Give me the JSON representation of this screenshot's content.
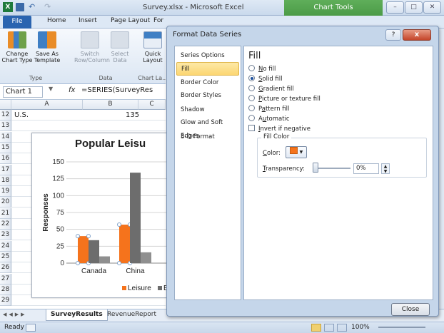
{
  "window": {
    "title": "Survey.xlsx - Microsoft Excel",
    "context_tab": "Chart Tools",
    "min": "–",
    "max": "□",
    "close": "✕"
  },
  "ribbon_tabs": [
    "File",
    "Home",
    "Insert",
    "Page Layout",
    "For"
  ],
  "ribbon": {
    "buttons": [
      {
        "label": "Change Chart Type"
      },
      {
        "label": "Save As Template"
      },
      {
        "label": "Switch Row/Column"
      },
      {
        "label": "Select Data"
      },
      {
        "label": "Quick Layout"
      }
    ],
    "groups": [
      "Type",
      "Data",
      "Chart La..."
    ]
  },
  "formula_bar": {
    "name_box": "Chart 1",
    "fx": "fx",
    "formula": "=SERIES(SurveyRes"
  },
  "sheet": {
    "columns": [
      "A",
      "B",
      "C"
    ],
    "rows": [
      "12",
      "13",
      "14",
      "15",
      "16",
      "17",
      "18",
      "19",
      "20",
      "21",
      "22",
      "23",
      "24",
      "25",
      "26",
      "27",
      "28",
      "29"
    ],
    "row12": {
      "a": "U.S.",
      "b": "135"
    }
  },
  "chart_data": {
    "type": "bar",
    "title": "Popular Leisu",
    "ylabel": "Responses",
    "ylim": [
      0,
      150
    ],
    "yticks": [
      0,
      25,
      50,
      75,
      100,
      125,
      150
    ],
    "categories": [
      "Canada",
      "China"
    ],
    "series": [
      {
        "name": "Leisure",
        "color": "#f5731c",
        "values": [
          40,
          57
        ]
      },
      {
        "name": "Bu",
        "color": "#6d6d6d",
        "values": [
          34,
          134
        ]
      },
      {
        "color": "#8f8f8f",
        "values": [
          10,
          16
        ]
      }
    ],
    "legend_position": "bottom"
  },
  "sheet_tabs": [
    "SurveyResults",
    "RevenueReport"
  ],
  "status": {
    "ready": "Ready",
    "zoom": "100%"
  },
  "dialog": {
    "title": "Format Data Series",
    "help": "?",
    "close_x": "x",
    "nav": [
      "Series Options",
      "Fill",
      "Border Color",
      "Border Styles",
      "Shadow",
      "Glow and Soft Edges",
      "3-D Format"
    ],
    "selected_nav": "Fill",
    "heading": "Fill",
    "fill_options": [
      {
        "label": "No fill",
        "key": "N",
        "checked": false
      },
      {
        "label": "Solid fill",
        "key": "S",
        "checked": true
      },
      {
        "label": "Gradient fill",
        "key": "G",
        "checked": false
      },
      {
        "label": "Picture or texture fill",
        "key": "P",
        "checked": false
      },
      {
        "label": "Pattern fill",
        "key": "a",
        "checked": false
      },
      {
        "label": "Automatic",
        "key": "u",
        "checked": false
      }
    ],
    "invert_label": "Invert if negative",
    "fill_color_group": "Fill Color",
    "color_label": "Color:",
    "transparency_label": "Transparency:",
    "transparency_value": "0%",
    "close_button": "Close"
  }
}
